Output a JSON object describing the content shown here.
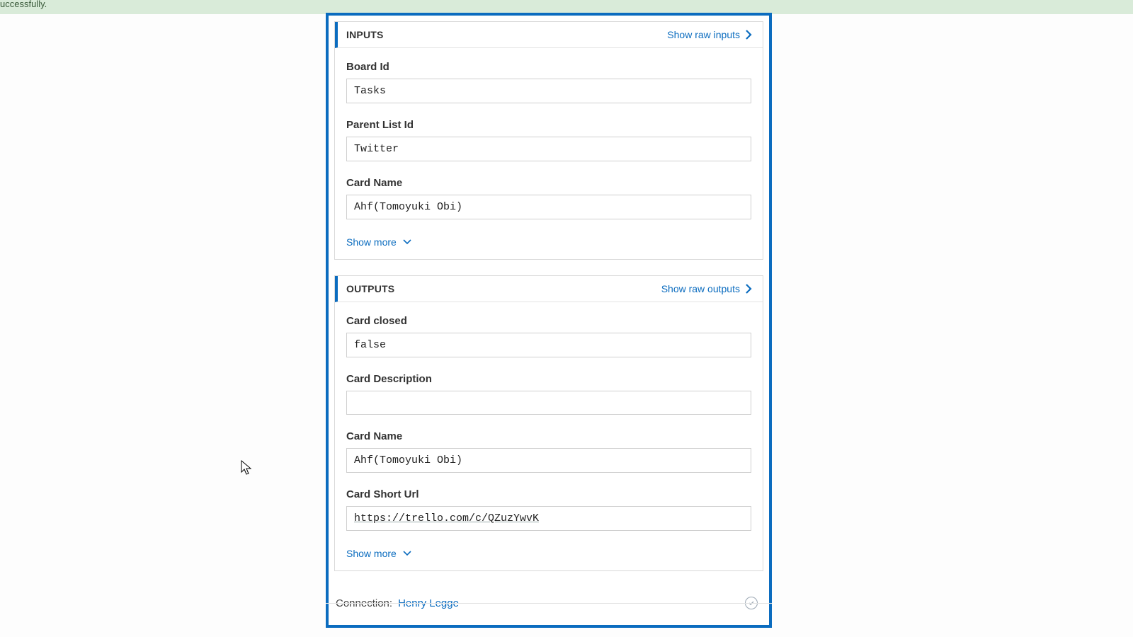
{
  "banner": {
    "text": "uccessfully."
  },
  "inputs": {
    "title": "INPUTS",
    "raw_link": "Show raw inputs",
    "fields": [
      {
        "label": "Board Id",
        "value": "Tasks"
      },
      {
        "label": "Parent List Id",
        "value": "Twitter"
      },
      {
        "label": "Card Name",
        "value": "Ahf(Tomoyuki Obi)"
      }
    ],
    "show_more": "Show more"
  },
  "outputs": {
    "title": "OUTPUTS",
    "raw_link": "Show raw outputs",
    "fields": [
      {
        "label": "Card closed",
        "value": "false"
      },
      {
        "label": "Card Description",
        "value": ""
      },
      {
        "label": "Card Name",
        "value": "Ahf(Tomoyuki Obi)"
      },
      {
        "label": "Card Short Url",
        "value": "https://trello.com/c/QZuzYwvK"
      }
    ],
    "show_more": "Show more"
  },
  "connection": {
    "label": "Connection:",
    "name": "Henry Legge"
  }
}
